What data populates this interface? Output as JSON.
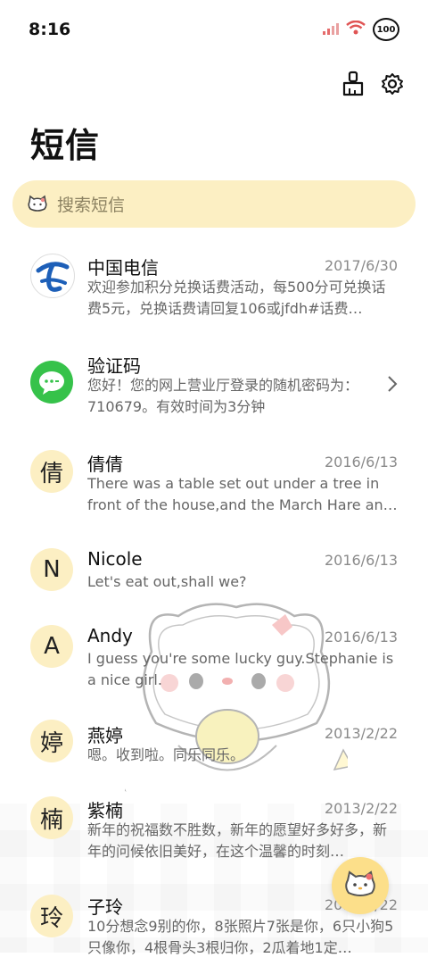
{
  "status": {
    "time": "8:16",
    "battery": "100"
  },
  "header": {
    "title": "短信"
  },
  "search": {
    "placeholder": "搜索短信"
  },
  "messages": [
    {
      "name": "中国电信",
      "date": "2017/6/30",
      "preview": "欢迎参加积分兑换话费活动，每500分可兑换话费5元，兑换话费请回复106或jfdh#话费…",
      "avatar": "telecom-logo"
    },
    {
      "name": "验证码",
      "date": "",
      "preview": "您好！您的网上营业厅登录的随机密码为：710679。有效时间为3分钟",
      "avatar": "message-bubble"
    },
    {
      "name": "倩倩",
      "date": "2016/6/13",
      "preview": "There was a table set out under a tree in front of the house,and the March Hare an…",
      "avatar_text": "倩"
    },
    {
      "name": "Nicole",
      "date": "2016/6/13",
      "preview": "Let's eat out,shall we?",
      "avatar_text": "N"
    },
    {
      "name": "Andy",
      "date": "2016/6/13",
      "preview": "I guess you're some lucky guy.Stephanie is a nice girl.",
      "avatar_text": "A"
    },
    {
      "name": "燕婷",
      "date": "2013/2/22",
      "preview": "嗯。收到啦。同乐同乐。",
      "avatar_text": "婷"
    },
    {
      "name": "紫楠",
      "date": "2013/2/22",
      "preview": "新年的祝福数不胜数，新年的愿望好多好多，新年的问候依旧美好，在这个温馨的时刻…",
      "avatar_text": "楠"
    },
    {
      "name": "子玲",
      "date": "2013/2/22",
      "preview": "10分想念9别的你，8张照片7张是你，6只小狗5只像你，4根骨头3根归你，2瓜着地1定…",
      "avatar_text": "玲"
    }
  ]
}
